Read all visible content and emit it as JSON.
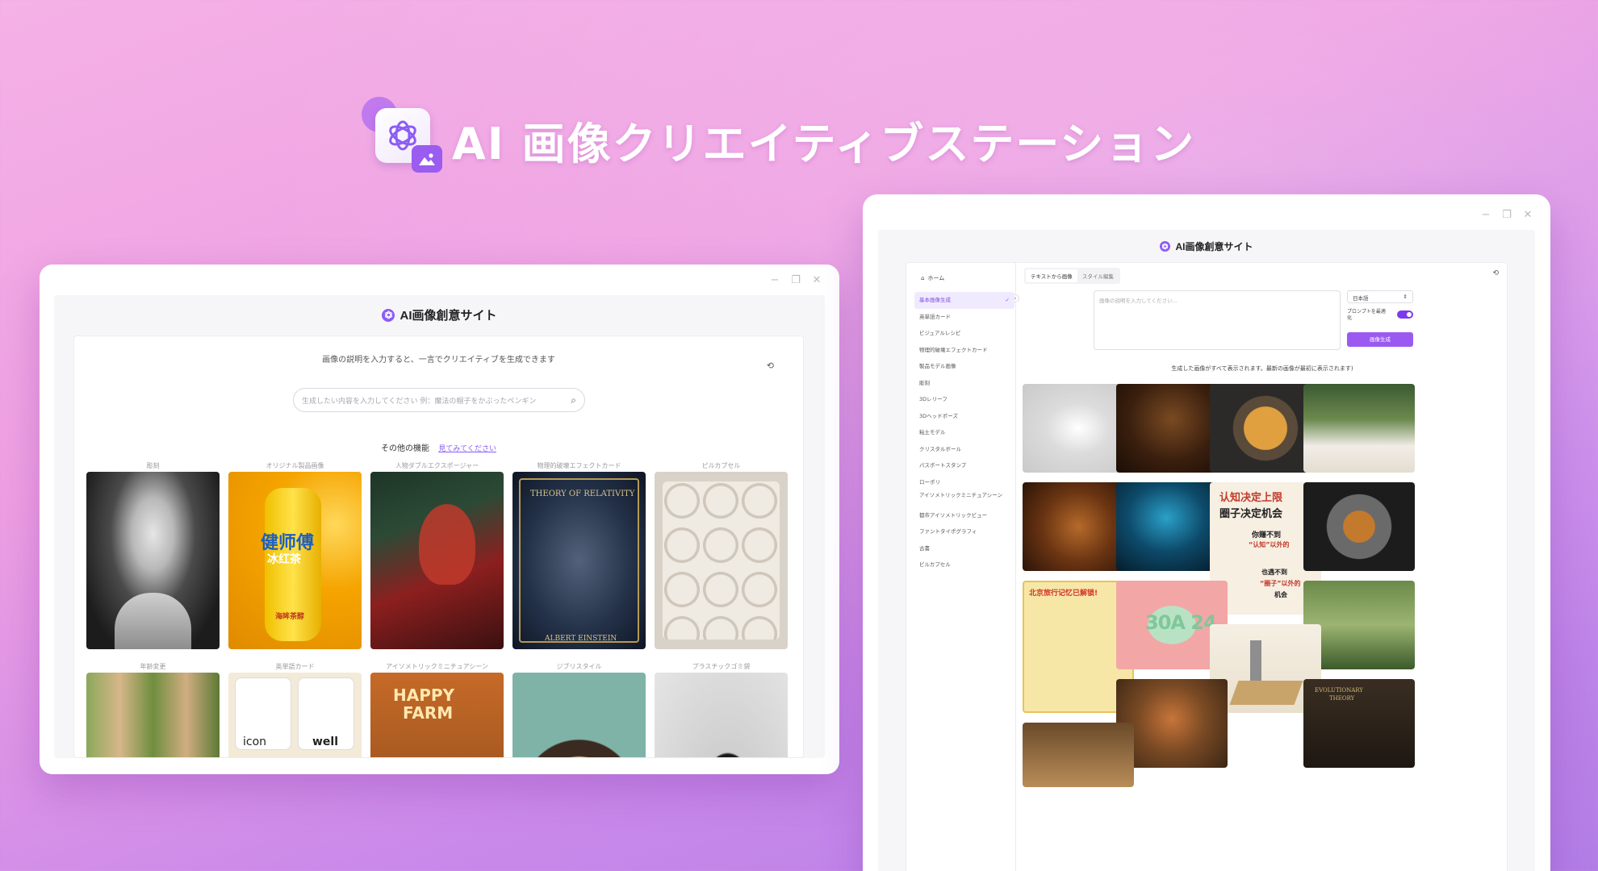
{
  "hero": {
    "title": "AI 画像クリエイティブステーション",
    "logo_icon": "openai-image-logo-icon"
  },
  "left_window": {
    "app_title": "AI画像創意サイト",
    "subtitle": "画像の説明を入力すると、一言でクリエイティブを生成できます",
    "search_placeholder": "生成したい内容を入力してください 例：魔法の帽子をかぶったペンギン",
    "other_label": "その他の機能",
    "other_link": "見てみてください",
    "row1": [
      {
        "caption": "彫刻"
      },
      {
        "caption": "オリジナル製品画像",
        "text1": "健师傅",
        "text2": "冰红茶",
        "text3": "海眸茶醇"
      },
      {
        "caption": "人物ダブルエクスポージャー"
      },
      {
        "caption": "物理的破壊エフェクトカード",
        "text1": "THEORY OF RELATIVITY",
        "text2": "ALBERT EINSTEIN"
      },
      {
        "caption": "ピルカプセル"
      }
    ],
    "row2": [
      {
        "caption": "年齢変更"
      },
      {
        "caption": "英単語カード",
        "text1": "icon",
        "text2": "well"
      },
      {
        "caption": "アイソメトリックミニチュアシーン",
        "text1": "HAPPY",
        "text2": "FARM"
      },
      {
        "caption": "ジブリスタイル"
      },
      {
        "caption": "プラスチックゴミ袋"
      }
    ]
  },
  "right_window": {
    "app_title": "AI画像創意サイト",
    "home_label": "ホーム",
    "sidebar_items": [
      "基本画像生成",
      "英単語カード",
      "ビジュアルレシピ",
      "物理的破壊エフェクトカード",
      "製品モデル画像",
      "彫刻",
      "3Dレリーフ",
      "3Dヘッドポーズ",
      "粘土モデル",
      "クリスタルボール",
      "パスポートスタンプ",
      "ローポリ",
      "アイソメトリックミニチュアシーン",
      "都市アイソメトリックビュー",
      "ファントタイポグラフィ",
      "古書",
      "ピルカプセル"
    ],
    "tabs": [
      "テキストから画像",
      "スタイル編集"
    ],
    "prompt_placeholder": "画像の説明を入力してください...",
    "language": "日本語",
    "optimize_label": "プロンプトを最適化",
    "generate_button": "画像生成",
    "info": "生成した画像がすべて表示されます。最新の画像が最初に表示されます)",
    "image_texts": {
      "poster1": "认知决定上限",
      "poster2": "圈子决定机会",
      "poster3": "你赚不到",
      "poster4": "“认知”以外的",
      "poster5": "也遇不到",
      "poster6": "“圈子”以外的",
      "poster7": "机会",
      "beijing": "北京旅行记忆已解锁!",
      "clay": "30A 24",
      "evo1": "EVOLUTIONARY",
      "evo2": "THEORY"
    }
  },
  "colors": {
    "accent": "#8b5cf6",
    "button": "#9b59f2",
    "bg_top": "#f5b2e6",
    "bg_bottom": "#b27ee6"
  }
}
